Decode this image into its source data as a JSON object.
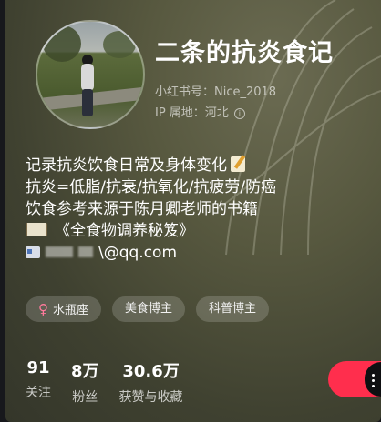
{
  "profile": {
    "nickname": "二条的抗炎食记",
    "id_text": "小红书号：Nice_2018",
    "ip_text": "IP 属地：河北",
    "info_icon": "info-icon",
    "bio": {
      "line1": "记录抗炎饮食日常及身体变化",
      "line2": "抗炎=低脂/抗衰/抗氧化/抗疲劳/防癌",
      "line3": "饮食参考来源于陈月卿老师的书籍",
      "line4": "《全食物调养秘笈》",
      "email_suffix": "\\@qq.com"
    },
    "tags": [
      "水瓶座",
      "美食博主",
      "科普博主"
    ],
    "stats": [
      {
        "value": "91",
        "label": "关注"
      },
      {
        "value": "8万",
        "label": "粉丝"
      },
      {
        "value": "30.6万",
        "label": "获赞与收藏"
      }
    ]
  },
  "colors": {
    "follow_button": "#ff2e4d",
    "gender_symbol": "#ff7a9c"
  }
}
